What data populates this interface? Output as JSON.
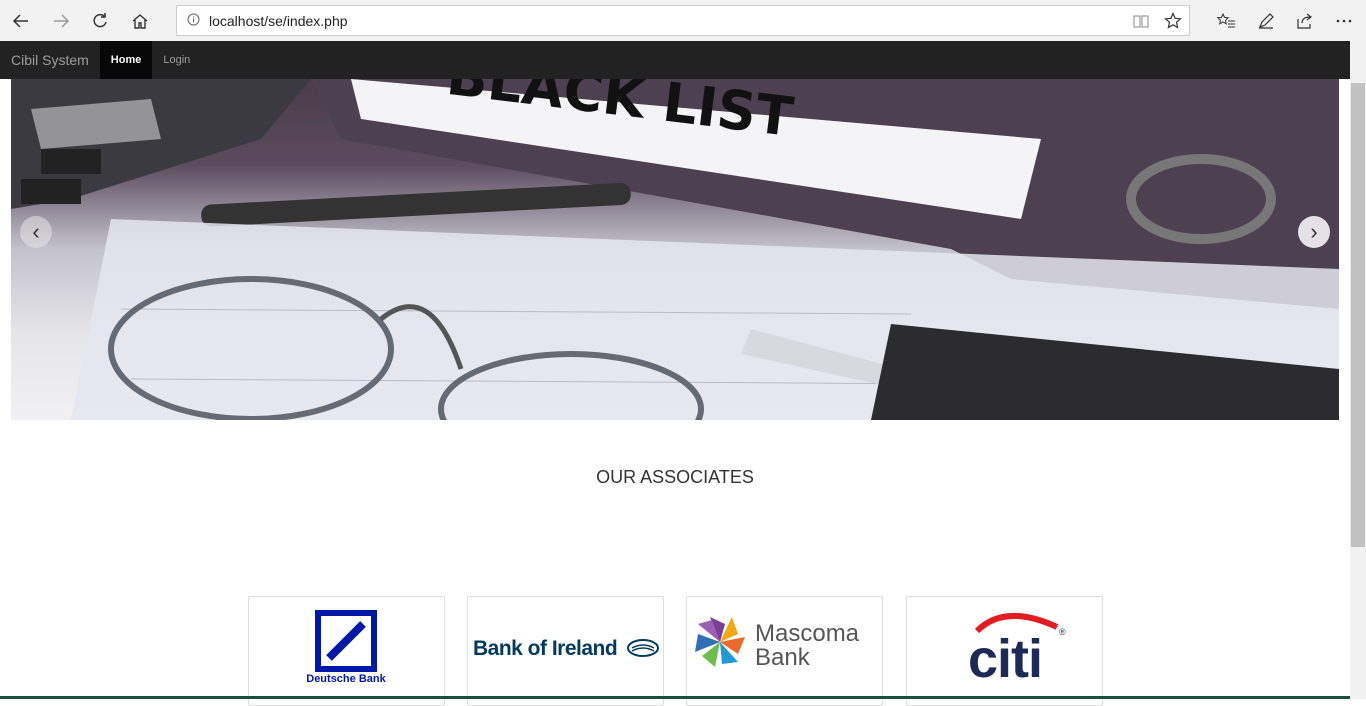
{
  "browser": {
    "url": "localhost/se/index.php"
  },
  "navbar": {
    "brand": "Cibil System",
    "items": [
      {
        "label": "Home",
        "active": true
      },
      {
        "label": "Login",
        "active": false
      }
    ]
  },
  "carousel": {
    "slide_text": "BLACK LIST"
  },
  "associates": {
    "title": "OUR ASSOCIATES",
    "banks": [
      {
        "name": "Deutsche Bank"
      },
      {
        "name": "Bank of Ireland"
      },
      {
        "name_line1": "Mascoma",
        "name_line2": "Bank"
      },
      {
        "name": "citi"
      }
    ]
  },
  "colors": {
    "navbar_bg": "#222222",
    "deutsche_blue": "#0018a8",
    "boi_navy": "#003a5d",
    "citi_navy": "#1b2a56",
    "citi_red": "#e31b23"
  }
}
